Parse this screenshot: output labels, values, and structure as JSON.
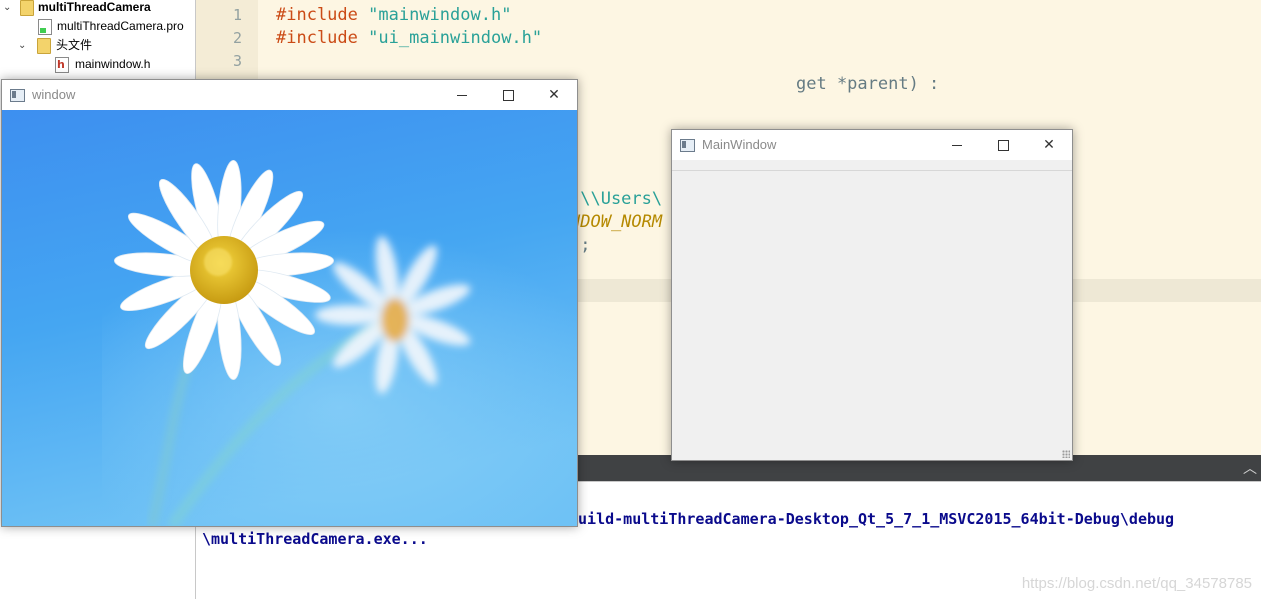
{
  "tree": {
    "items": [
      {
        "label": "multiThreadCamera",
        "bold": true
      },
      {
        "label": "multiThreadCamera.pro"
      },
      {
        "label": "头文件"
      },
      {
        "label": "mainwindow.h"
      }
    ]
  },
  "editor": {
    "line_numbers": [
      "1",
      "2",
      "3"
    ],
    "line1": {
      "kw": "#include",
      "str": "\"mainwindow.h\""
    },
    "line2": {
      "kw": "#include",
      "str": "\"ui_mainwindow.h\""
    },
    "line4_tail": "get *parent) :",
    "line8_frag": ":\\\\Users\\",
    "line9_frag": "NDOW_NORM",
    "line10_frag": ");"
  },
  "output": {
    "line1": "build-multiThreadCamera-Desktop_Qt_5_7_1_MSVC2015_64bit-Debug\\debug",
    "line2": "\\multiThreadCamera.exe..."
  },
  "watermark": "https://blog.csdn.net/qq_34578785",
  "window_image": {
    "title": "window"
  },
  "main_window": {
    "title": "MainWindow"
  },
  "colors": {
    "editor_bg": "#fdf6e3",
    "keyword": "#cb4b16",
    "string": "#2aa198",
    "output_text": "#0a0a8c",
    "sky_blue": "#3a9ef0"
  }
}
